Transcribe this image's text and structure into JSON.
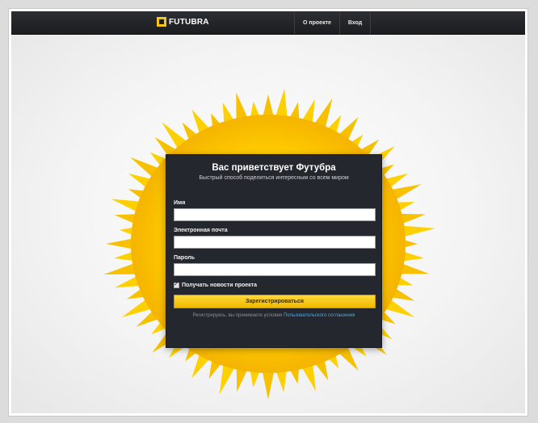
{
  "navbar": {
    "logo_text": "FUTUBRA",
    "links": [
      {
        "label": "О проекте"
      },
      {
        "label": "Вход"
      }
    ]
  },
  "signup": {
    "title": "Вас приветствует Футубра",
    "subtitle": "Быстрый способ поделиться интересным со всем миром",
    "name_label": "Имя",
    "name_value": "",
    "email_label": "Электронная почта",
    "email_value": "",
    "password_label": "Пароль",
    "password_value": "",
    "newsletter_label": "Получать новости проекта",
    "newsletter_checked": true,
    "submit_label": "Зарегистрироваться",
    "terms_prefix": "Регистрируясь, вы принимаете условия ",
    "terms_link": "Пользовательского соглашения"
  },
  "colors": {
    "accent": "#f5c518",
    "card_bg": "#24282e",
    "link": "#4ba7e6"
  }
}
